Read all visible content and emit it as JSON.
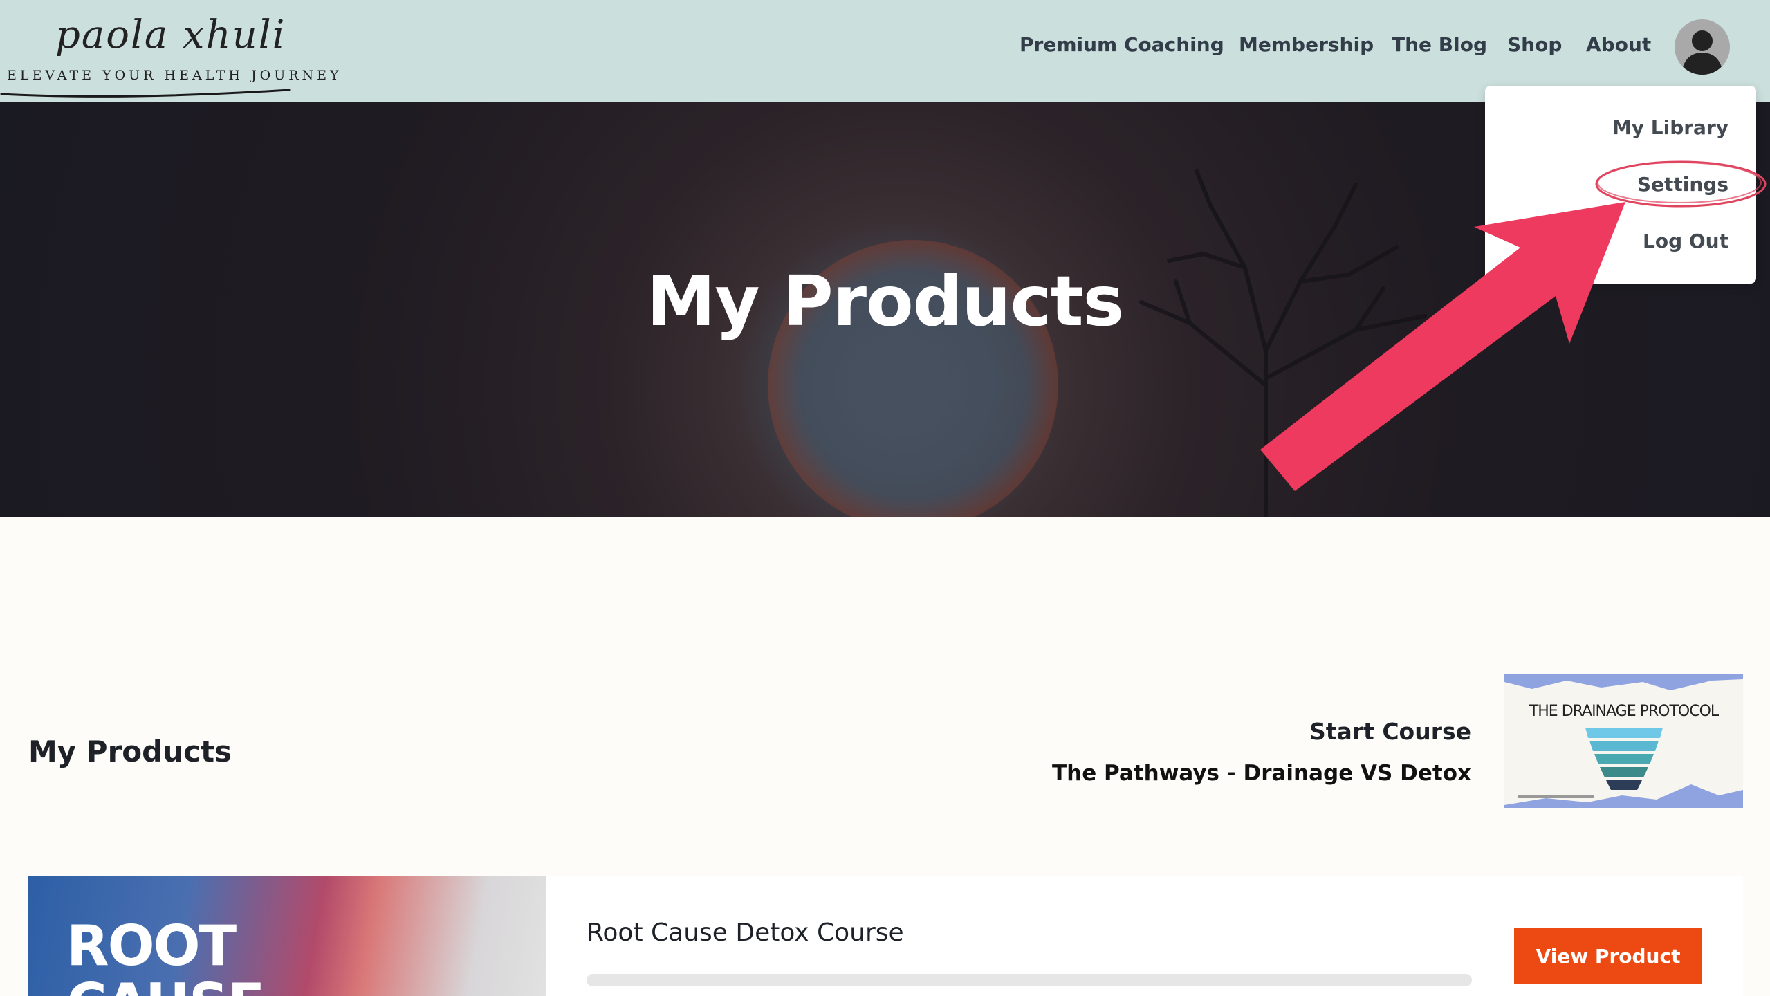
{
  "brand": {
    "script_name": "paola xhuli",
    "tagline": "ELEVATE YOUR HEALTH JOURNEY"
  },
  "nav": {
    "items": [
      "Premium Coaching",
      "Membership",
      "The Blog",
      "Shop",
      "About"
    ]
  },
  "account_menu": {
    "avatar_icon": "user-silhouette-icon",
    "items": [
      "My Library",
      "Settings",
      "Log Out"
    ],
    "highlighted_item": "Settings"
  },
  "annotation": {
    "arrow_color": "#ee3a5e",
    "circle_color": "#e0455f"
  },
  "hero": {
    "title": "My Products"
  },
  "content": {
    "section_title": "My Products",
    "featured": {
      "action_label": "Start Course",
      "product_name": "The Pathways - Drainage VS Detox",
      "thumbnail_title": "THE DRAINAGE PROTOCOL"
    },
    "products": [
      {
        "image_text": "ROOT\nCAUSE",
        "name": "Root Cause Detox Course",
        "progress_fraction": 0,
        "button_label": "View Product"
      }
    ]
  },
  "colors": {
    "header_bg": "#cbdfdd",
    "page_bg": "#fdfcf8",
    "button_bg": "#ec4a12"
  }
}
